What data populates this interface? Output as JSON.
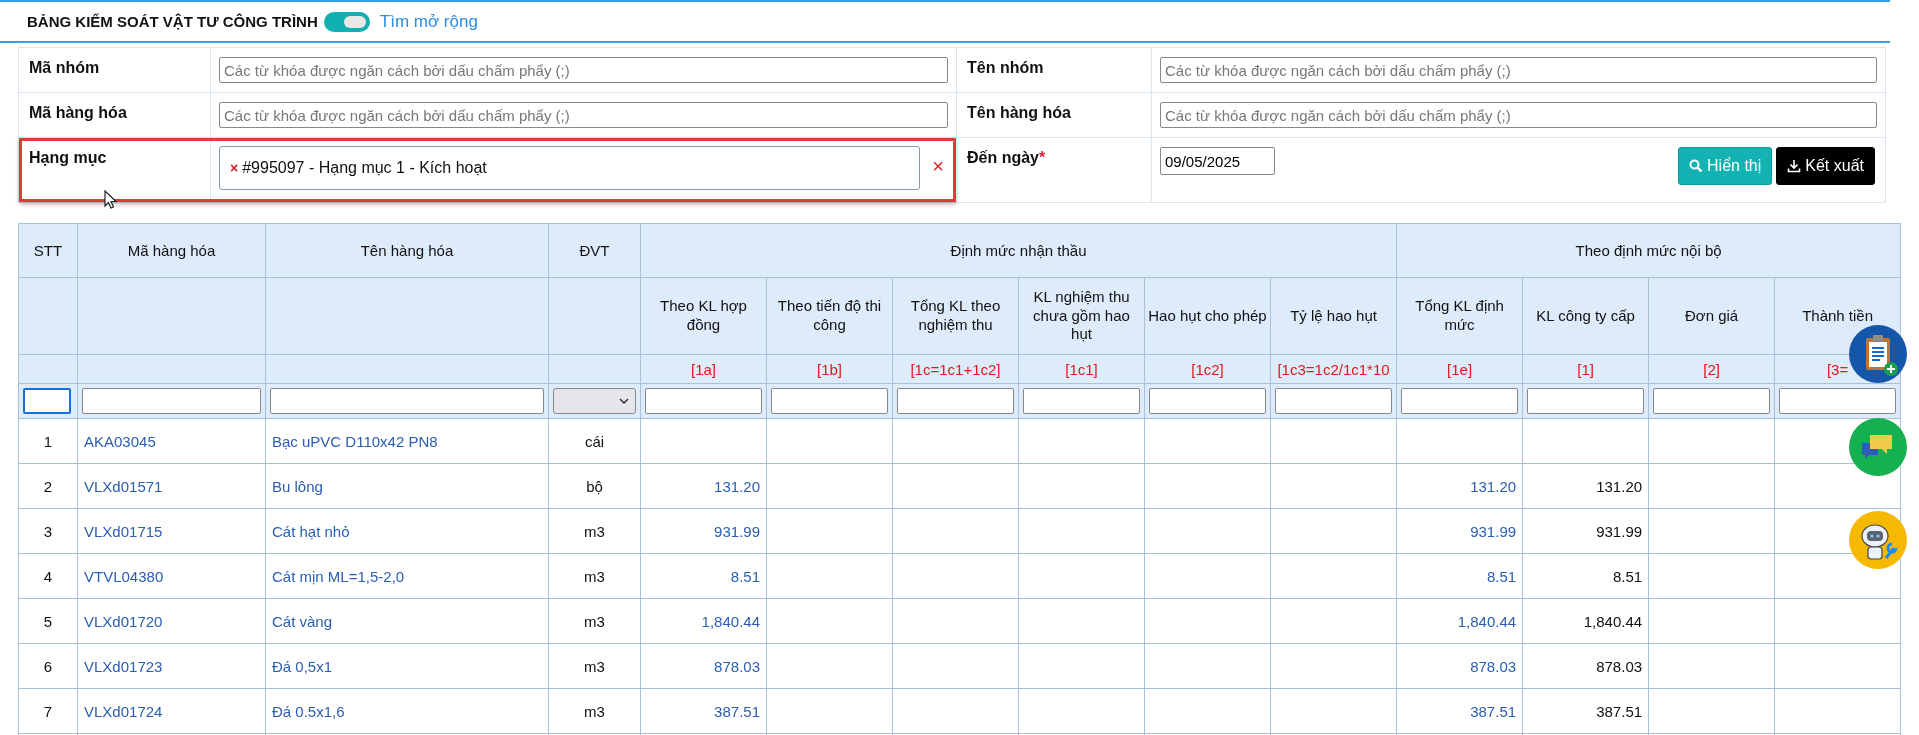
{
  "title": "BẢNG KIỂM SOÁT VẬT TƯ CÔNG TRÌNH",
  "extended_search": {
    "label": "Tìm mở rộng",
    "on": true
  },
  "form_rows": [
    {
      "fields": [
        {
          "label": "Mã nhóm",
          "kind": "text",
          "placeholder": "Các từ khóa được ngăn cách bởi dấu chấm phẩy (;)"
        },
        {
          "label": "Tên nhóm",
          "kind": "text",
          "placeholder": "Các từ khóa được ngăn cách bởi dấu chấm phẩy (;)"
        }
      ]
    },
    {
      "fields": [
        {
          "label": "Mã hàng hóa",
          "kind": "text",
          "placeholder": "Các từ khóa được ngăn cách bởi dấu chấm phẩy (;)"
        },
        {
          "label": "Tên hàng hóa",
          "kind": "text",
          "placeholder": "Các từ khóa được ngăn cách bởi dấu chấm phẩy (;)"
        }
      ]
    },
    {
      "fields": [
        {
          "label": "Hạng mục",
          "kind": "tags",
          "highlighted": true,
          "tags": [
            "#995097 - Hạng mục 1 - Kích hoạt"
          ],
          "tag_remove": "×",
          "clear": "×"
        },
        {
          "label": "Đến ngày",
          "kind": "date",
          "required": true,
          "required_mark": "*",
          "value": "09/05/2025",
          "buttons": [
            {
              "label": "Hiển thị",
              "kind": "search"
            },
            {
              "label": "Kết xuất",
              "kind": "export"
            }
          ]
        }
      ]
    }
  ],
  "table": {
    "fixed_columns": [
      "STT",
      "Mã hàng hóa",
      "Tên hàng hóa",
      "ĐVT"
    ],
    "groups": [
      {
        "label": "Định mức nhận thầu",
        "columns": [
          {
            "label": "Theo KL hợp đồng",
            "code": "[1a]"
          },
          {
            "label": "Theo tiến độ thi công",
            "code": "[1b]"
          },
          {
            "label": "Tổng KL theo nghiệm thu",
            "code": "[1c=1c1+1c2]"
          },
          {
            "label": "KL nghiệm thu chưa gồm hao hụt",
            "code": "[1c1]"
          },
          {
            "label": "Hao hụt cho phép",
            "code": "[1c2]"
          },
          {
            "label": "Tỷ lệ hao hụt",
            "code": "[1c3=1c2/1c1*10"
          }
        ]
      },
      {
        "label": "Theo định mức nội bộ",
        "columns": [
          {
            "label": "Tổng KL định mức",
            "code": "[1e]"
          },
          {
            "label": "KL công ty cấp",
            "code": "[1]"
          },
          {
            "label": "Đơn giá",
            "code": "[2]"
          },
          {
            "label": "Thành tiền",
            "code": "[3="
          }
        ]
      }
    ],
    "filters": [
      {
        "kind": "text",
        "focused": true
      },
      {
        "kind": "text",
        "focused": false
      },
      {
        "kind": "text",
        "focused": false
      },
      {
        "kind": "select",
        "focused": false
      },
      {
        "kind": "text",
        "focused": false
      },
      {
        "kind": "text",
        "focused": false
      },
      {
        "kind": "text",
        "focused": false
      },
      {
        "kind": "text",
        "focused": false
      },
      {
        "kind": "text",
        "focused": false
      },
      {
        "kind": "text",
        "focused": false
      },
      {
        "kind": "text",
        "focused": false
      },
      {
        "kind": "text",
        "focused": false
      },
      {
        "kind": "text",
        "focused": false
      },
      {
        "kind": "text",
        "focused": false
      }
    ],
    "rows": [
      {
        "stt": "1",
        "code": "AKA03045",
        "name": "Bạc uPVC D110x42 PN8",
        "unit": "cái"
      },
      {
        "stt": "2",
        "code": "VLXd01571",
        "name": "Bu lông",
        "unit": "bộ",
        "contract_qty": "131.20",
        "norm_total_qty": "131.20",
        "company_supplied_qty": "131.20"
      },
      {
        "stt": "3",
        "code": "VLXd01715",
        "name": "Cát hạt nhỏ",
        "unit": "m3",
        "contract_qty": "931.99",
        "norm_total_qty": "931.99",
        "company_supplied_qty": "931.99"
      },
      {
        "stt": "4",
        "code": "VTVL04380",
        "name": "Cát mịn ML=1,5-2,0",
        "unit": "m3",
        "contract_qty": "8.51",
        "norm_total_qty": "8.51",
        "company_supplied_qty": "8.51"
      },
      {
        "stt": "5",
        "code": "VLXd01720",
        "name": "Cát vàng",
        "unit": "m3",
        "contract_qty": "1,840.44",
        "norm_total_qty": "1,840.44",
        "company_supplied_qty": "1,840.44"
      },
      {
        "stt": "6",
        "code": "VLXd01723",
        "name": "Đá 0,5x1",
        "unit": "m3",
        "contract_qty": "878.03",
        "norm_total_qty": "878.03",
        "company_supplied_qty": "878.03"
      },
      {
        "stt": "7",
        "code": "VLXd01724",
        "name": "Đá 0.5x1,6",
        "unit": "m3",
        "contract_qty": "387.51",
        "norm_total_qty": "387.51",
        "company_supplied_qty": "387.51"
      }
    ]
  },
  "floating_buttons": [
    {
      "kind": "clipboard"
    },
    {
      "kind": "chat"
    },
    {
      "kind": "robot"
    }
  ]
}
